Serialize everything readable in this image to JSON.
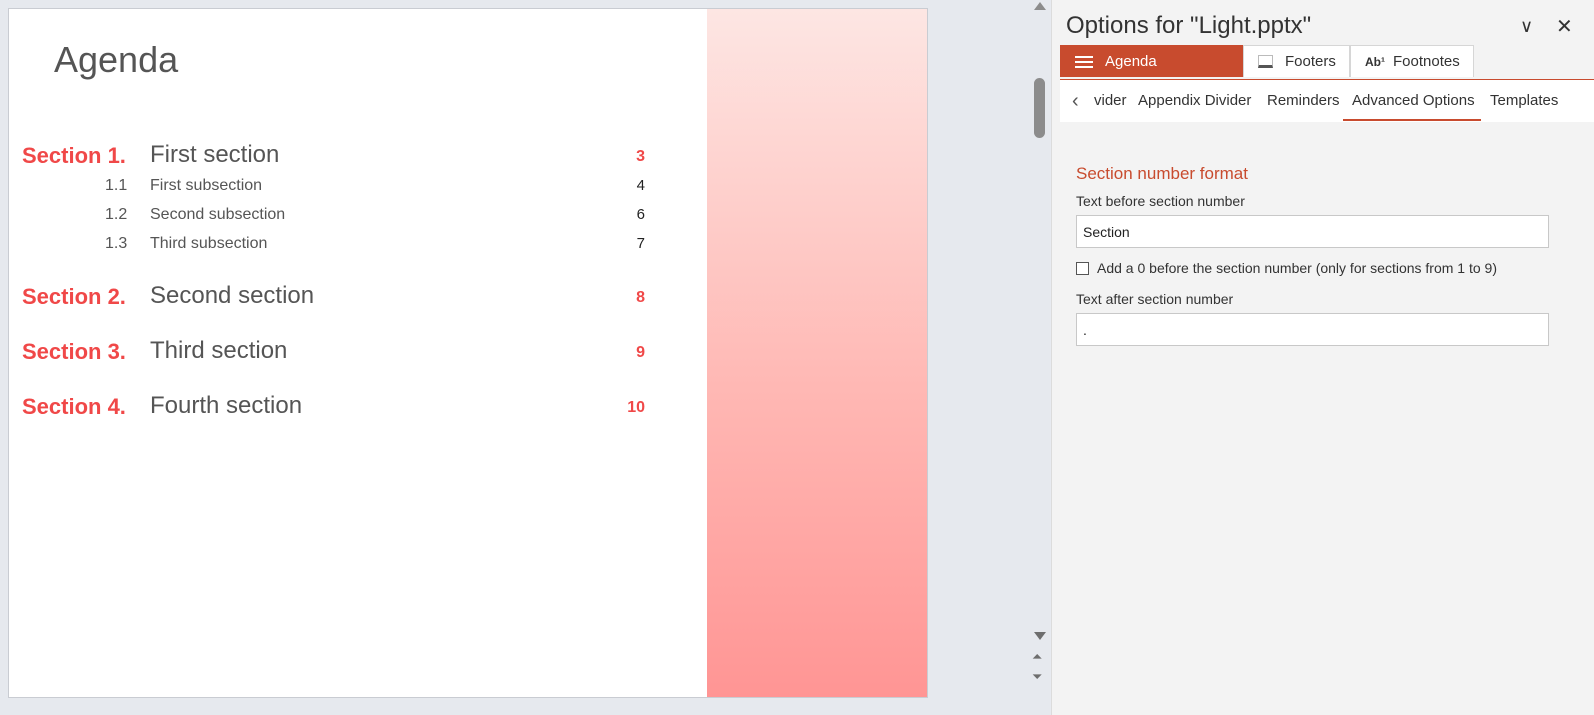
{
  "slide": {
    "title": "Agenda",
    "sections": [
      {
        "num": "Section 1.",
        "title": "First section",
        "page": "3",
        "subsections": [
          {
            "num": "1.1",
            "title": "First subsection",
            "page": "4"
          },
          {
            "num": "1.2",
            "title": "Second subsection",
            "page": "6"
          },
          {
            "num": "1.3",
            "title": "Third subsection",
            "page": "7"
          }
        ]
      },
      {
        "num": "Section 2.",
        "title": "Second section",
        "page": "8"
      },
      {
        "num": "Section 3.",
        "title": "Third section",
        "page": "9"
      },
      {
        "num": "Section 4.",
        "title": "Fourth section",
        "page": "10"
      }
    ]
  },
  "scrollbar": {
    "up_icon": "▲",
    "down_icon": "▼",
    "prev_icon": "⏶",
    "next_icon": "⏷"
  },
  "pane": {
    "title": "Options for \"Light.pptx\"",
    "collapse_icon": "∨",
    "close_icon": "✕",
    "main_tabs": [
      {
        "label": "Agenda",
        "icon": "hamburger-icon"
      },
      {
        "label": "Footers",
        "icon": "footer-icon"
      },
      {
        "label": "Footnotes",
        "icon": "footnote-icon",
        "icon_text": "Ab¹"
      }
    ],
    "sub_tabs": [
      "vider",
      "Appendix Divider",
      "Reminders",
      "Advanced Options",
      "Templates"
    ],
    "active_sub_tab": "Advanced Options",
    "chevron_icon": "‹",
    "section_heading": "Section number format",
    "text_before_label": "Text before section number",
    "text_before_value": "Section",
    "checkbox_label": "Add a 0 before the section number (only for sections from 1 to 9)",
    "checkbox_checked": false,
    "text_after_label": "Text after section number",
    "text_after_value": "."
  },
  "colors": {
    "accent": "#c84b2e",
    "section_red": "#f04848"
  }
}
